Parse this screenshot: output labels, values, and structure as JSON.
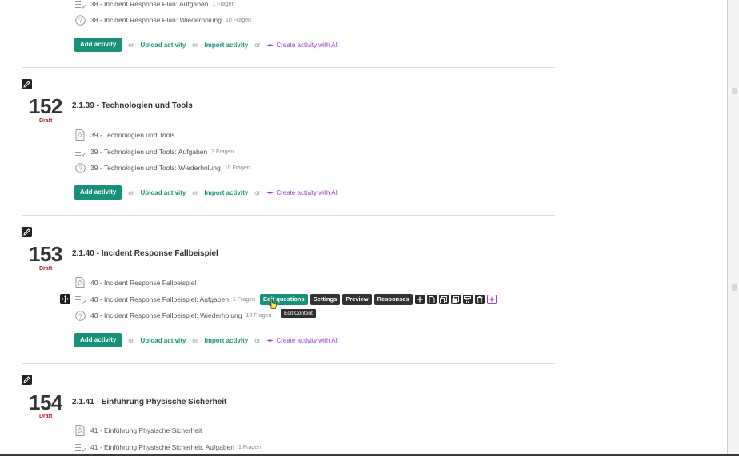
{
  "common": {
    "add_activity": "Add activity",
    "or": "or",
    "upload_activity": "Upload activity",
    "import_activity": "Import activity",
    "create_ai": "Create activity with AI"
  },
  "prev_section": {
    "activities": [
      {
        "label": "38 - Incident Response Plan: Aufgaben",
        "meta": "1 Fragen",
        "icon": "checklist-icon"
      },
      {
        "label": "38 - Incident Response Plan: Wiederholung",
        "meta": "10 Fragen",
        "icon": "question-icon"
      }
    ]
  },
  "sections": [
    {
      "number": "152",
      "status": "Draft",
      "title": "2.1.39 - Technologien und Tools",
      "activities": [
        {
          "label": "39 - Technologien und Tools",
          "meta": "",
          "icon": "pdf-icon"
        },
        {
          "label": "39 - Technologien und Tools: Aufgaben",
          "meta": "3 Fragen",
          "icon": "checklist-icon"
        },
        {
          "label": "39 - Technologien und Tools: Wiederholung",
          "meta": "10 Fragen",
          "icon": "question-icon"
        }
      ]
    },
    {
      "number": "153",
      "status": "Draft",
      "title": "2.1.40 - Incident Response Fallbeispiel",
      "activities": [
        {
          "label": "40 - Incident Response Fallbeispiel",
          "meta": "",
          "icon": "pdf-icon"
        },
        {
          "label": "40 - Incident Response Fallbeispiel: Aufgaben",
          "meta": "1 Fragen",
          "icon": "checklist-icon"
        },
        {
          "label": "40 - Incident Response Fallbeispiel: Wiederholung",
          "meta": "10 Fragen",
          "icon": "question-icon"
        }
      ]
    },
    {
      "number": "154",
      "status": "Draft",
      "title": "2.1.41 - Einführung Physische Sicherheit",
      "activities": [
        {
          "label": "41 - Einführung Physische Sicherheit",
          "meta": "",
          "icon": "pdf-icon"
        },
        {
          "label": "41 - Einführung Physische Sicherheit: Aufgaben",
          "meta": "1 Fragen",
          "icon": "checklist-icon"
        }
      ]
    }
  ],
  "toolbar": {
    "edit_questions": "Edit questions",
    "settings": "Settings",
    "preview": "Preview",
    "responses": "Responses",
    "tooltip": "Edit Content",
    "icons": [
      "plus-icon",
      "file-icon",
      "copy-icon",
      "duplicate-icon",
      "filter-icon",
      "trash-icon",
      "ai-sparkle-icon"
    ]
  },
  "colors": {
    "accent": "#17917a",
    "draft": "#b22222",
    "ai": "#9a3fd1"
  }
}
